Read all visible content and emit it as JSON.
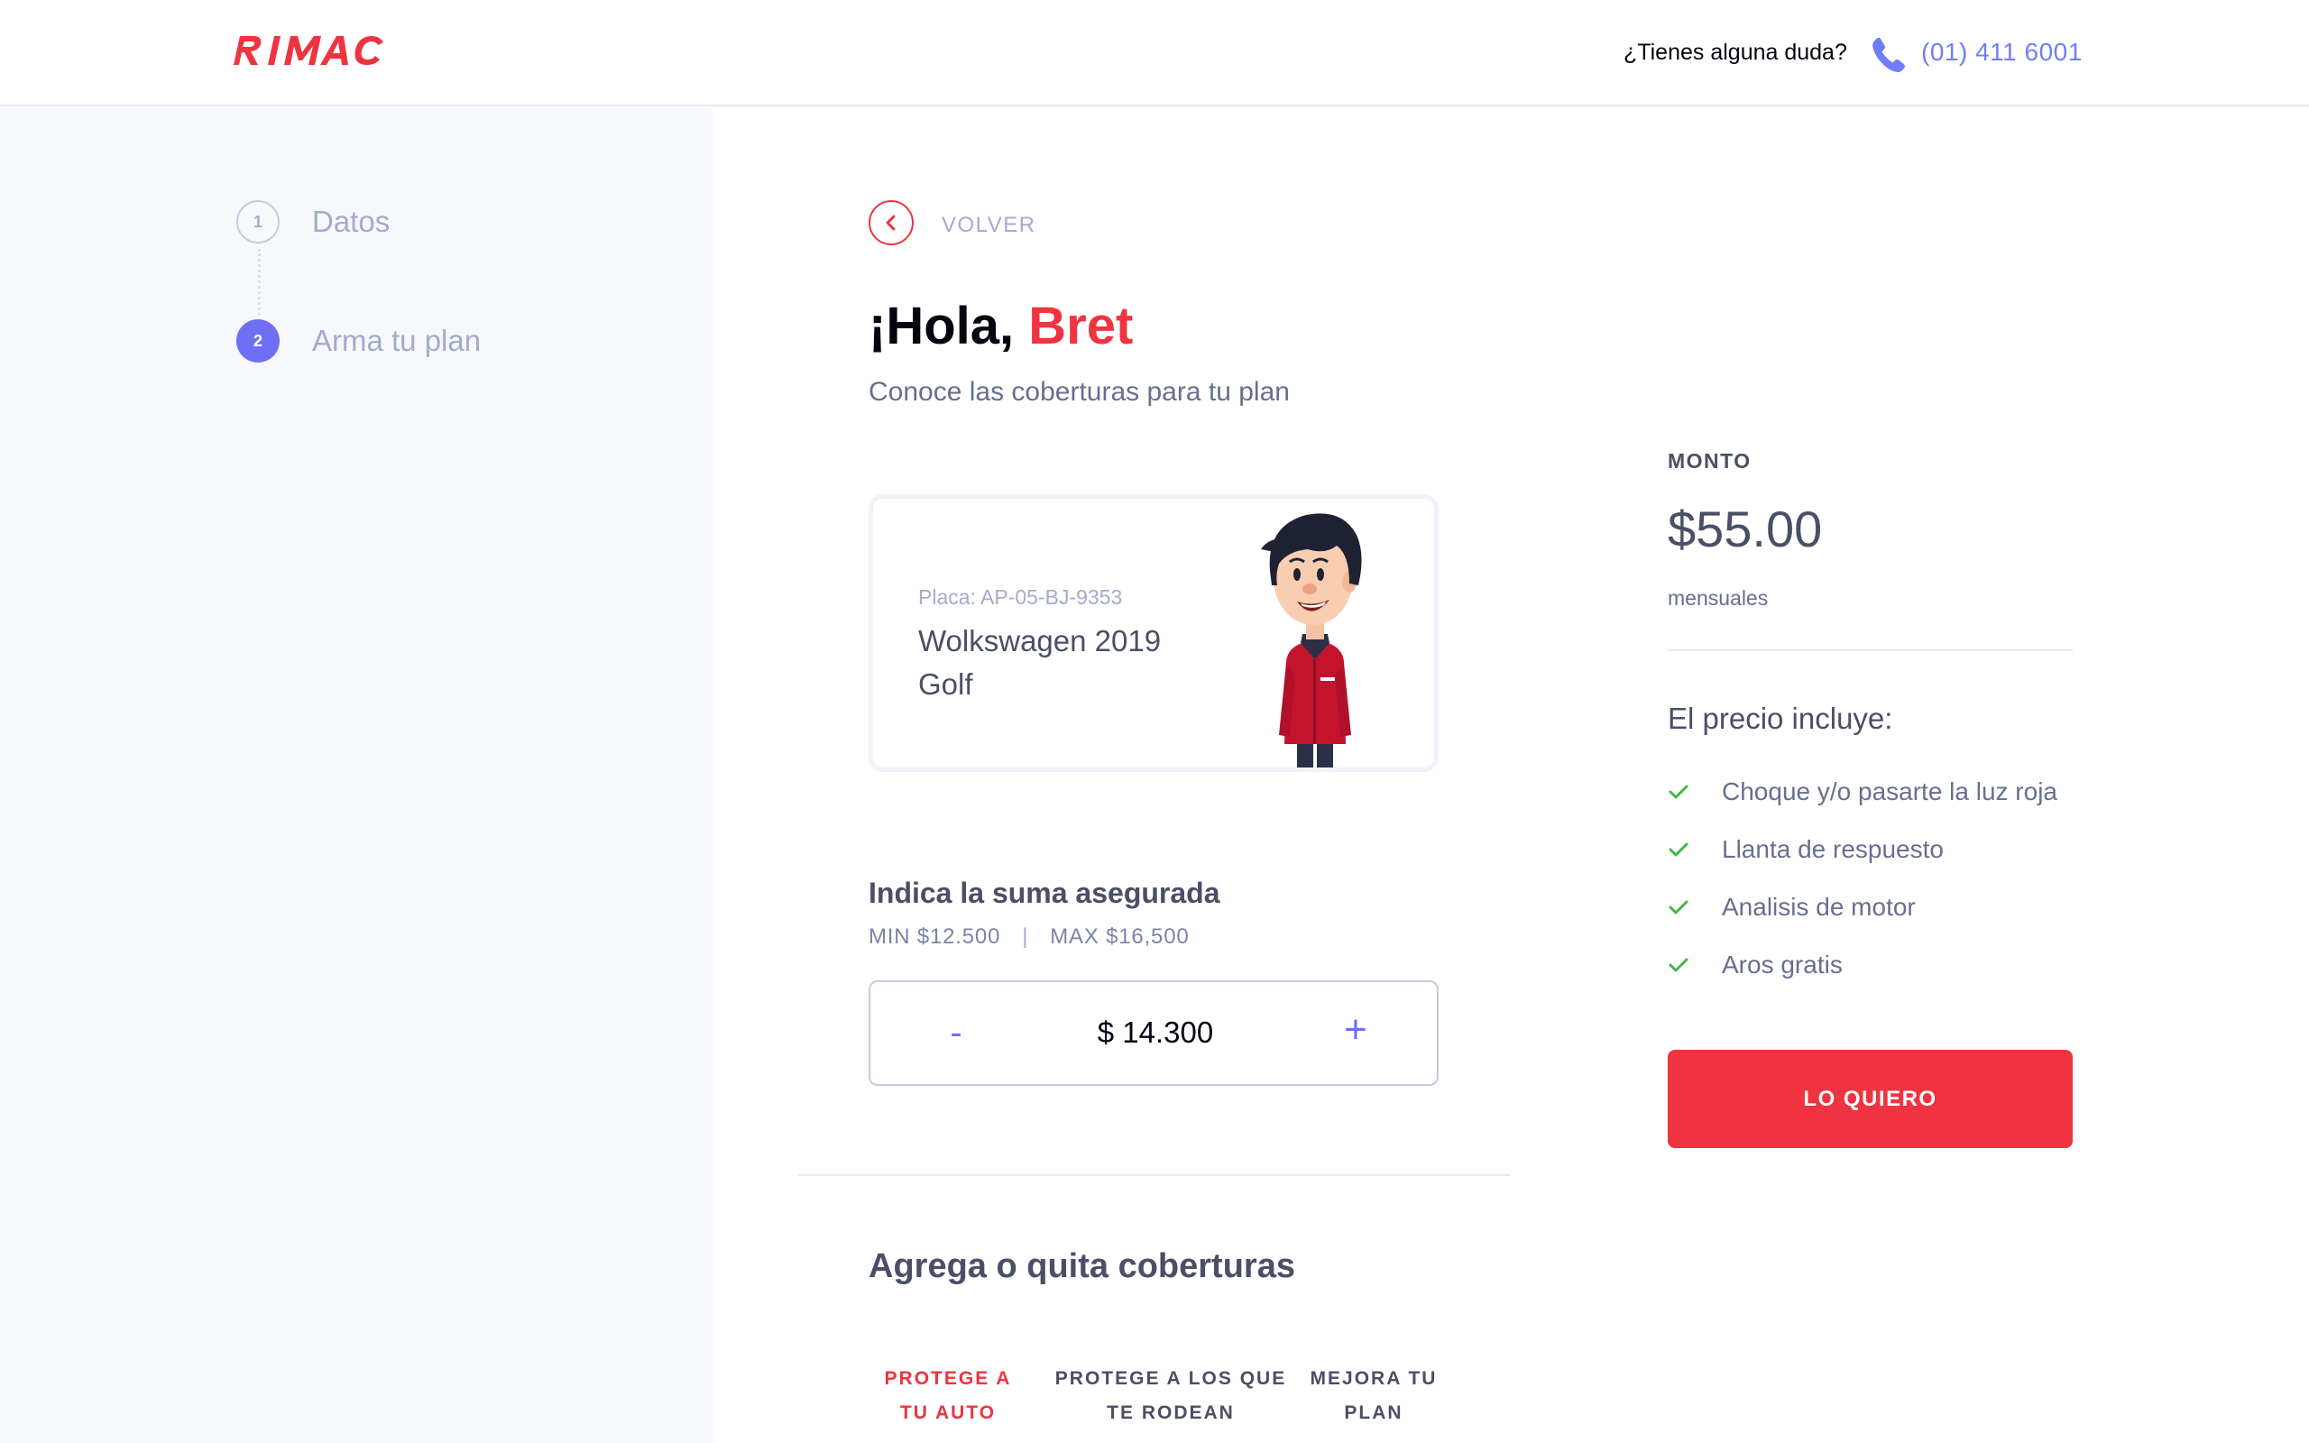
{
  "header": {
    "logo_text": "RIMAC",
    "help_text": "¿Tienes alguna duda?",
    "phone_icon": "phone-icon",
    "phone_number": "(01) 411 6001"
  },
  "sidebar": {
    "steps": [
      {
        "number": "1",
        "label": "Datos",
        "state": "completed"
      },
      {
        "number": "2",
        "label": "Arma tu plan",
        "state": "active"
      }
    ]
  },
  "main": {
    "back_label": "VOLVER",
    "greeting_prefix": "¡Hola,",
    "greeting_name": "Bret",
    "subtitle": "Conoce las coberturas para tu plan",
    "car": {
      "plate": "Placa: AP-05-BJ-9353",
      "name": "Wolkswagen 2019 Golf"
    },
    "sum": {
      "title": "Indica la suma asegurada",
      "min": "MIN $12.500",
      "separator": "|",
      "max": "MAX $16,500",
      "minus": "-",
      "value": "$ 14.300",
      "plus": "+"
    },
    "coverage_title": "Agrega o quita coberturas",
    "tabs": [
      {
        "label": "PROTEGE A TU AUTO",
        "active": true
      },
      {
        "label": "PROTEGE A LOS QUE TE RODEAN",
        "active": false
      },
      {
        "label": "MEJORA TU PLAN",
        "active": false
      }
    ]
  },
  "summary": {
    "amount_label": "MONTO",
    "amount_value": "$55.00",
    "amount_period": "mensuales",
    "includes_title": "El precio incluye:",
    "includes": [
      "Choque y/o pasarte la luz roja",
      "Llanta de respuesto",
      "Analisis de motor",
      "Aros gratis"
    ],
    "cta_label": "LO QUIERO"
  },
  "colors": {
    "brand_red": "#ef3340",
    "accent_purple": "#6f6ff5",
    "check_green": "#43b748",
    "sidebar_bg": "#f7f8fc"
  }
}
